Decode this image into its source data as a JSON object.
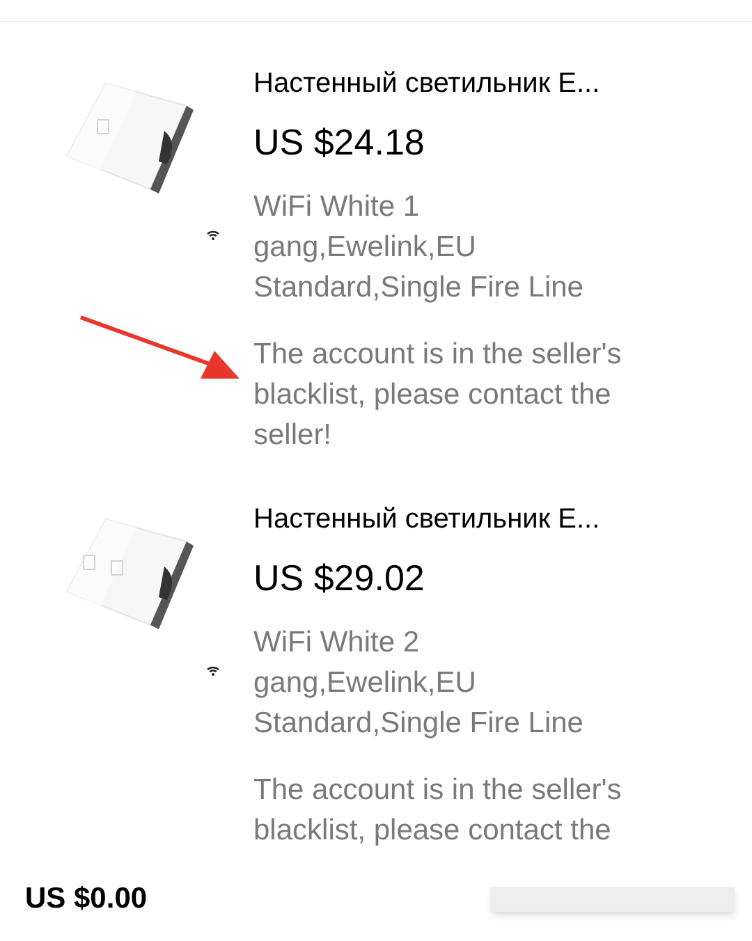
{
  "items": [
    {
      "title": "Настенный светильник E...",
      "price": "US $24.18",
      "variant": "WiFi White 1 gang,Ewelink,EU Standard,Single Fire Line",
      "notice": "The account is in the seller's blacklist, please contact the seller!",
      "annotated": true
    },
    {
      "title": "Настенный светильник E...",
      "price": "US $29.02",
      "variant": "WiFi White 2 gang,Ewelink,EU Standard,Single Fire Line",
      "notice": "The account is in the seller's blacklist, please contact the",
      "annotated": false
    }
  ],
  "footer": {
    "total": "US $0.00"
  }
}
